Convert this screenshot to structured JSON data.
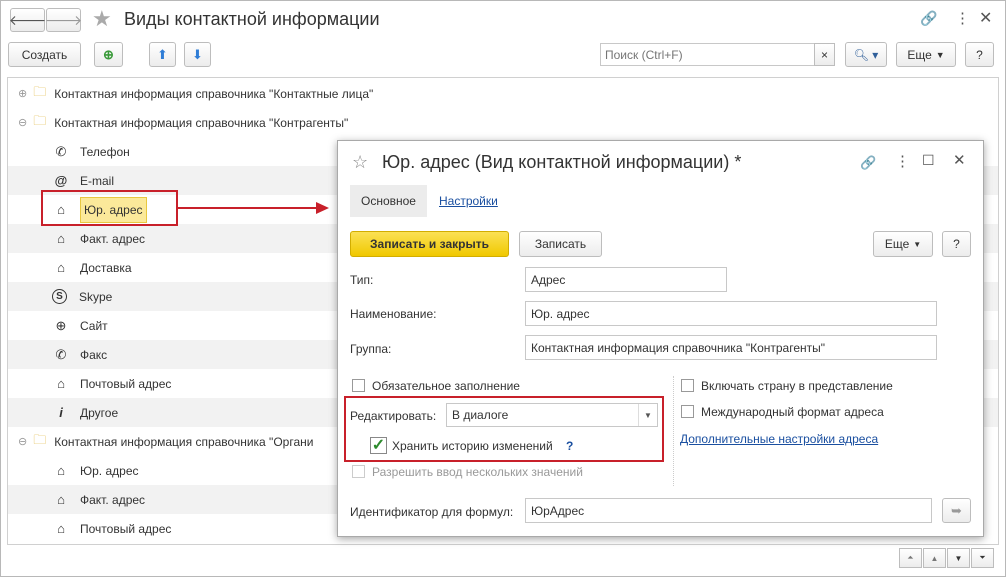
{
  "window": {
    "title": "Виды контактной информации"
  },
  "toolbar": {
    "create_label": "Создать",
    "search_placeholder": "Поиск (Ctrl+F)",
    "search_clear": "×",
    "more_label": "Еще",
    "help_label": "?"
  },
  "tree": {
    "groups": [
      {
        "label": "Контактная информация справочника \"Контактные лица\"",
        "toggle": "⊕"
      },
      {
        "label": "Контактная информация справочника \"Контрагенты\"",
        "toggle": "⊖"
      },
      {
        "label": "Контактная информация справочника \"Органи",
        "toggle": "⊖"
      }
    ],
    "items_contractors": [
      {
        "label": "Телефон",
        "icon": "phone-icon",
        "glyph": "✆"
      },
      {
        "label": "E-mail",
        "icon": "at-icon",
        "glyph": "@"
      },
      {
        "label": "Юр. адрес",
        "icon": "house-icon",
        "glyph": "⌂"
      },
      {
        "label": "Факт. адрес",
        "icon": "house-icon",
        "glyph": "⌂"
      },
      {
        "label": "Доставка",
        "icon": "house-icon",
        "glyph": "⌂"
      },
      {
        "label": "Skype",
        "icon": "skype-icon",
        "glyph": "S"
      },
      {
        "label": "Сайт",
        "icon": "globe-icon",
        "glyph": "⊕"
      },
      {
        "label": "Факс",
        "icon": "fax-icon",
        "glyph": "✆"
      },
      {
        "label": "Почтовый адрес",
        "icon": "house-icon",
        "glyph": "⌂"
      },
      {
        "label": "Другое",
        "icon": "info-icon",
        "glyph": "i"
      }
    ],
    "items_org": [
      {
        "label": "Юр. адрес",
        "glyph": "⌂"
      },
      {
        "label": "Факт. адрес",
        "glyph": "⌂"
      },
      {
        "label": "Почтовый адрес",
        "glyph": "⌂"
      }
    ]
  },
  "dialog": {
    "title": "Юр. адрес (Вид контактной информации) *",
    "tabs": [
      "Основное",
      "Настройки"
    ],
    "save_close_label": "Записать и закрыть",
    "save_label": "Записать",
    "more_label": "Еще",
    "help_label": "?",
    "type_label": "Тип:",
    "type_value": "Адрес",
    "name_label": "Наименование:",
    "name_value": "Юр. адрес",
    "group_label": "Группа:",
    "group_value": "Контактная информация справочника \"Контрагенты\"",
    "mandatory_label": "Обязательное заполнение",
    "edit_label": "Редактировать:",
    "edit_value": "В диалоге",
    "history_label": "Хранить историю изменений",
    "history_help": "?",
    "multi_label": "Разрешить ввод нескольких значений",
    "country_label": "Включать страну в представление",
    "intl_label": "Международный формат адреса",
    "extra_link": "Дополнительные настройки адреса",
    "formula_label": "Идентификатор для формул:",
    "formula_value": "ЮрАдрес"
  },
  "colors": {
    "accent_yellow": "#f5d11c",
    "highlight_red": "#c8202a",
    "link": "#1a4fa0"
  }
}
